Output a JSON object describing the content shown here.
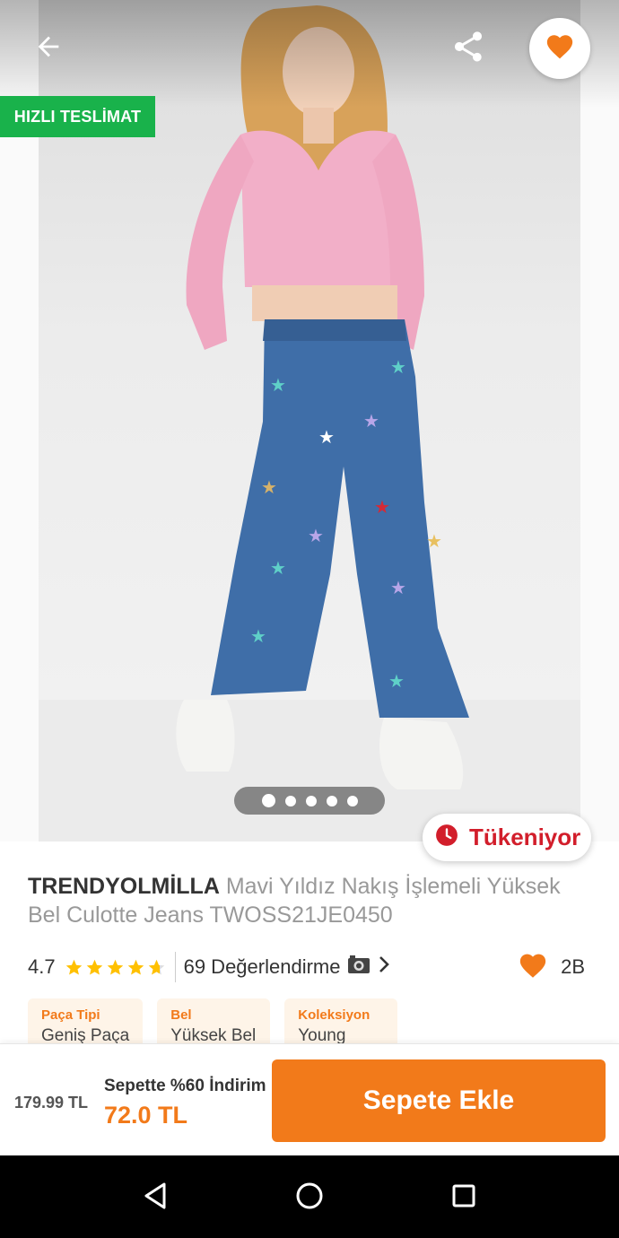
{
  "hero": {
    "fast_delivery_badge": "HIZLI TESLİMAT",
    "stock_label": "Tükeniyor",
    "image_count": 5,
    "active_image": 1,
    "icons": {
      "back": "arrow-left-icon",
      "share": "share-icon",
      "favorite": "heart-icon",
      "stock": "clock-icon"
    }
  },
  "product": {
    "brand": "TRENDYOLMİLLA",
    "name": "Mavi Yıldız Nakış İşlemeli Yüksek Bel Culotte Jeans TWOSS21JE0450",
    "rating": "4.7",
    "rating_value": 4.7,
    "rating_max": 5,
    "reviews_label": "69 Değerlendirme",
    "reviews_icon": "camera-icon",
    "likes_count": "2B",
    "attributes": [
      {
        "key": "Paça Tipi",
        "value": "Geniş Paça"
      },
      {
        "key": "Bel",
        "value": "Yüksek Bel"
      },
      {
        "key": "Koleksiyon",
        "value": "Young"
      }
    ]
  },
  "buybar": {
    "old_price": "179.99 TL",
    "discount_label": "Sepette %60 İndirim",
    "new_price": "72.0 TL",
    "add_to_cart": "Sepete Ekle"
  },
  "colors": {
    "accent": "#f27a1a",
    "badge_green": "#19b24b",
    "stock_red": "#d21e2b"
  }
}
